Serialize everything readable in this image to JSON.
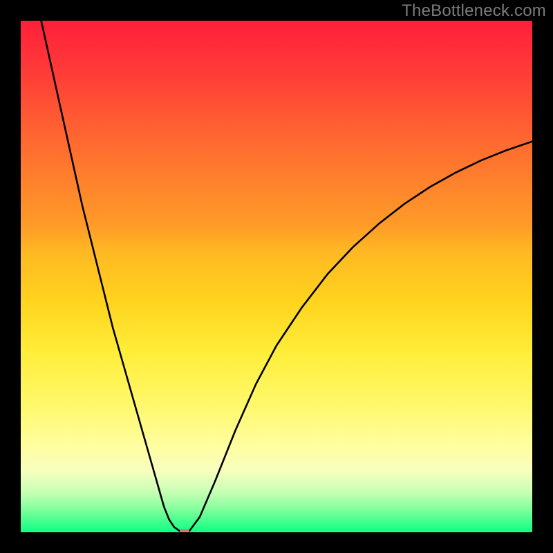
{
  "watermark": "TheBottleneck.com",
  "chart_data": {
    "type": "line",
    "title": "",
    "xlabel": "",
    "ylabel": "",
    "xlim": [
      0,
      100
    ],
    "ylim": [
      0,
      100
    ],
    "grid": false,
    "legend": false,
    "background_gradient": {
      "top": "#ff1f3a",
      "mid": "#ffee3a",
      "bottom": "#0cff85"
    },
    "series": [
      {
        "name": "bottleneck-curve",
        "color": "#000000",
        "x": [
          4.0,
          6.0,
          8.0,
          10.0,
          12.0,
          14.0,
          16.0,
          18.0,
          20.0,
          22.0,
          24.0,
          26.0,
          27.0,
          28.0,
          29.0,
          30.0,
          31.0,
          32.0,
          33.0,
          35.0,
          38.0,
          42.0,
          46.0,
          50.0,
          55.0,
          60.0,
          65.0,
          70.0,
          75.0,
          80.0,
          85.0,
          90.0,
          95.0,
          100.0
        ],
        "y": [
          100.0,
          91.0,
          82.0,
          73.0,
          64.0,
          56.0,
          48.0,
          40.0,
          33.0,
          26.0,
          19.0,
          12.0,
          8.5,
          5.0,
          2.5,
          1.0,
          0.3,
          0.0,
          0.3,
          3.0,
          10.0,
          20.0,
          29.0,
          36.5,
          44.0,
          50.5,
          55.8,
          60.3,
          64.2,
          67.5,
          70.3,
          72.7,
          74.7,
          76.4
        ]
      }
    ],
    "marker": {
      "name": "optimal-point",
      "x": 32.0,
      "y": 0.0,
      "color": "#d47a6e"
    }
  }
}
